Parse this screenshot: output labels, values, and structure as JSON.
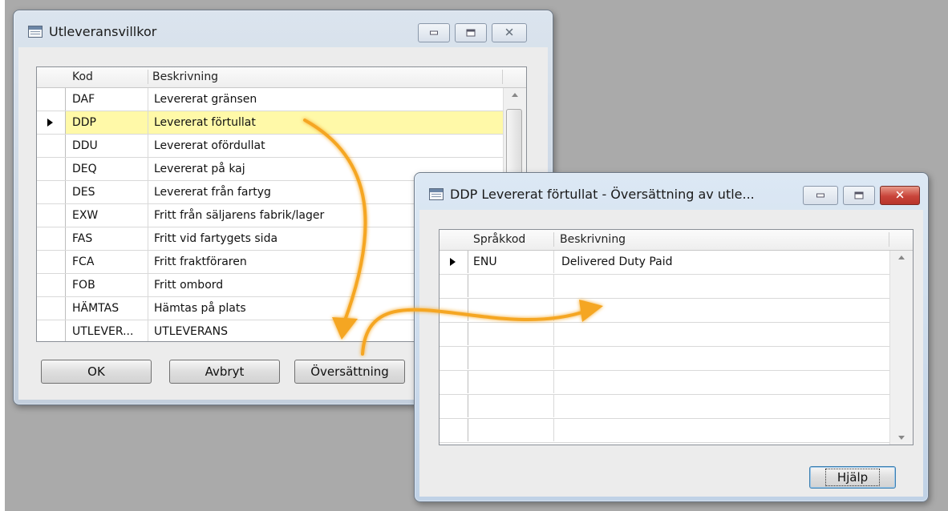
{
  "window1": {
    "title": "Utleveransvillkor",
    "columns": {
      "code": "Kod",
      "description": "Beskrivning"
    },
    "rows": [
      {
        "code": "DAF",
        "description": "Levererat gränsen",
        "current": false
      },
      {
        "code": "DDP",
        "description": "Levererat förtullat",
        "current": true
      },
      {
        "code": "DDU",
        "description": "Levererat ofördullat",
        "current": false
      },
      {
        "code": "DEQ",
        "description": "Levererat på kaj",
        "current": false
      },
      {
        "code": "DES",
        "description": "Levererat från fartyg",
        "current": false
      },
      {
        "code": "EXW",
        "description": "Fritt från säljarens fabrik/lager",
        "current": false
      },
      {
        "code": "FAS",
        "description": "Fritt vid fartygets sida",
        "current": false
      },
      {
        "code": "FCA",
        "description": "Fritt fraktföraren",
        "current": false
      },
      {
        "code": "FOB",
        "description": "Fritt ombord",
        "current": false
      },
      {
        "code": "HÄMTAS",
        "description": "Hämtas på plats",
        "current": false
      },
      {
        "code": "UTLEVER...",
        "description": "UTLEVERANS",
        "current": false
      }
    ],
    "buttons": {
      "ok": "OK",
      "cancel": "Avbryt",
      "translation": "Översättning"
    }
  },
  "window2": {
    "title": "DDP Levererat förtullat - Översättning av utle...",
    "columns": {
      "language_code": "Språkkod",
      "description": "Beskrivning"
    },
    "rows": [
      {
        "language_code": "ENU",
        "description": "Delivered Duty Paid",
        "current": true
      }
    ],
    "empty_rows": 7,
    "buttons": {
      "help": "Hjälp"
    }
  },
  "colors": {
    "current_row": "#fff9a8",
    "annotation_arrow": "#f5a623",
    "desktop": "#aaaaaa"
  },
  "icons": [
    "table-icon",
    "minimize-icon",
    "maximize-icon",
    "close-icon",
    "row-pointer-icon",
    "scroll-up-icon",
    "scroll-down-icon"
  ]
}
